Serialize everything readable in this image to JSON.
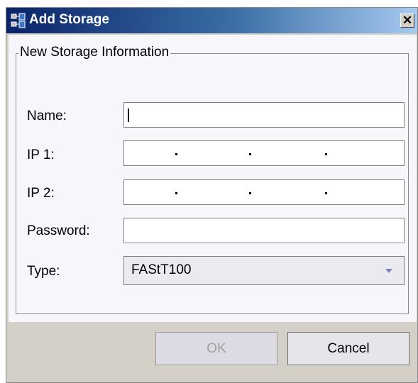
{
  "window": {
    "title": "Add Storage",
    "close_glyph": "✕",
    "icon": "storage-network-icon"
  },
  "group": {
    "legend": "New Storage Information"
  },
  "fields": {
    "name": {
      "label": "Name:",
      "value": ""
    },
    "ip1": {
      "label": "IP 1:",
      "value": ""
    },
    "ip2": {
      "label": "IP 2:",
      "value": ""
    },
    "password": {
      "label": "Password:",
      "value": ""
    },
    "type": {
      "label": "Type:",
      "selected": "FAStT100"
    }
  },
  "buttons": {
    "ok": "OK",
    "cancel": "Cancel"
  },
  "colors": {
    "title_start": "#0a246a",
    "title_end": "#a6caf0",
    "dialog_bg": "#d4d0c8",
    "panel_bg": "#f7f7fb"
  }
}
